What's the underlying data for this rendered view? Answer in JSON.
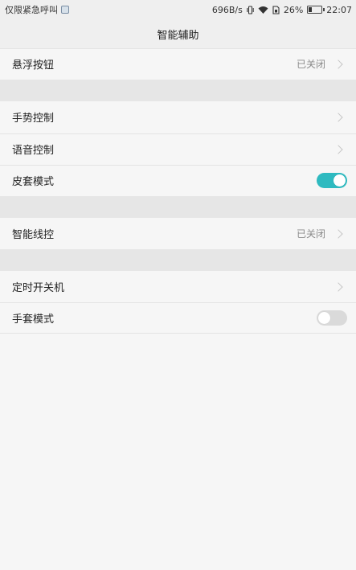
{
  "status_bar": {
    "carrier": "仅限紧急呼叫",
    "speed": "696B/s",
    "battery": "26%",
    "time": "22:07",
    "icons": [
      "sim-icon",
      "vibrate-icon",
      "wifi-icon",
      "sim-card-icon",
      "battery-icon"
    ]
  },
  "header": {
    "title": "智能辅助"
  },
  "rows": {
    "floating_button": {
      "label": "悬浮按钮",
      "value": "已关闭"
    },
    "gesture_control": {
      "label": "手势控制"
    },
    "voice_control": {
      "label": "语音控制"
    },
    "cover_mode": {
      "label": "皮套模式",
      "toggle": "on"
    },
    "smart_wire_control": {
      "label": "智能线控",
      "value": "已关闭"
    },
    "scheduled_power": {
      "label": "定时开关机"
    },
    "glove_mode": {
      "label": "手套模式",
      "toggle": "off"
    }
  },
  "colors": {
    "accent": "#2ebac0",
    "background": "#f6f6f6",
    "section_gap": "#e6e6e6",
    "toggle_off": "#dadada"
  }
}
